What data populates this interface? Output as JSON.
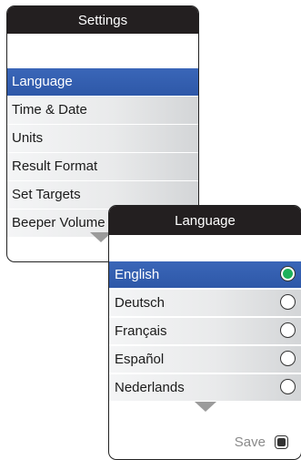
{
  "settings_panel": {
    "title": "Settings",
    "items": [
      {
        "label": "Language",
        "selected": true
      },
      {
        "label": "Time & Date",
        "selected": false
      },
      {
        "label": "Units",
        "selected": false
      },
      {
        "label": "Result Format",
        "selected": false
      },
      {
        "label": "Set Targets",
        "selected": false
      },
      {
        "label": "Beeper Volume",
        "selected": false
      }
    ],
    "scroll_icon": "chevron-down-icon"
  },
  "language_panel": {
    "title": "Language",
    "options": [
      {
        "label": "English",
        "selected": true
      },
      {
        "label": "Deutsch",
        "selected": false
      },
      {
        "label": "Français",
        "selected": false
      },
      {
        "label": "Español",
        "selected": false
      },
      {
        "label": "Nederlands",
        "selected": false
      }
    ],
    "scroll_icon": "chevron-down-icon",
    "save_label": "Save",
    "save_icon": "save-button-icon"
  },
  "colors": {
    "titlebar": "#231f20",
    "selection": "#2e58a8",
    "radio_selected": "#1db15a",
    "scroll_arrow": "#9b9b9b"
  }
}
